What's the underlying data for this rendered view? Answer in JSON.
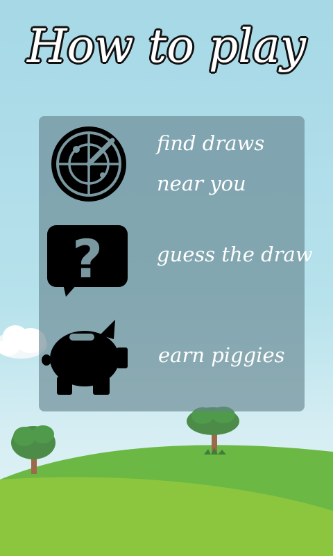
{
  "title": "How to play",
  "steps": [
    {
      "icon": "radar-icon",
      "line1": "find draws",
      "line2": "near you"
    },
    {
      "icon": "question-speech-bubble-icon",
      "text": "guess the draw"
    },
    {
      "icon": "piggy-bank-icon",
      "text": "earn piggies"
    }
  ],
  "colors": {
    "sky_top": "#a6d8e6",
    "hill_dark": "#6cb845",
    "hill_light": "#8cc63f",
    "tree_foliage": "#4c8c48",
    "tree_trunk": "#9b6a48"
  }
}
